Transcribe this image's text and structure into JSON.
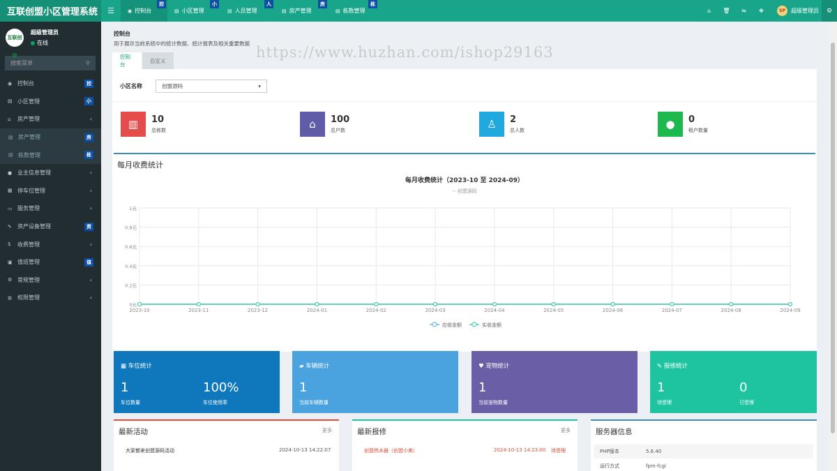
{
  "app": {
    "title": "互联创盟小区管理系统"
  },
  "topnav": [
    {
      "label": "控制台",
      "badge": "控",
      "active": true
    },
    {
      "label": "小区管理",
      "badge": "小",
      "active": false
    },
    {
      "label": "人员管理",
      "badge": "人",
      "active": false
    },
    {
      "label": "房产管理",
      "badge": "房",
      "active": false
    },
    {
      "label": "栋数管理",
      "badge": "栋",
      "active": false
    }
  ],
  "topuser": {
    "name": "超级管理员",
    "avatar_text": "SP"
  },
  "sidebar": {
    "user": {
      "name": "超级管理员",
      "status": "在线",
      "avatar_text": "互联创盟"
    },
    "search_placeholder": "搜索菜单",
    "items": [
      {
        "label": "控制台",
        "badge": "控",
        "icon": "dashboard-icon"
      },
      {
        "label": "小区管理",
        "badge": "小",
        "icon": "list-icon"
      },
      {
        "label": "房产管理",
        "chev": "‹",
        "icon": "home-icon"
      },
      {
        "label": "房产管理",
        "badge": "房",
        "sub": true,
        "icon": "list-icon"
      },
      {
        "label": "栋数管理",
        "badge": "栋",
        "sub": true,
        "icon": "list-icon"
      },
      {
        "label": "业主信息管理",
        "chev": "‹",
        "icon": "user-icon"
      },
      {
        "label": "停车位管理",
        "chev": "‹",
        "icon": "film-icon"
      },
      {
        "label": "服务管理",
        "chev": "‹",
        "icon": "desktop-icon"
      },
      {
        "label": "资产设备管理",
        "badge": "资",
        "icon": "wrench-icon"
      },
      {
        "label": "收费管理",
        "chev": "‹",
        "icon": "dollar-icon"
      },
      {
        "label": "值班管理",
        "badge": "值",
        "icon": "calendar-icon"
      },
      {
        "label": "常规管理",
        "chev": "‹",
        "icon": "cogs-icon"
      },
      {
        "label": "权限管理",
        "chev": "‹",
        "icon": "group-icon"
      }
    ]
  },
  "page": {
    "title": "控制台",
    "desc": "用于展示当前系统中的统计数据、统计报表及相关重要数据",
    "watermark": "https://www.huzhan.com/ishop29163",
    "tabs": [
      "控制台",
      "自定义"
    ]
  },
  "filter": {
    "label": "小区名称",
    "value": "创盟源码"
  },
  "stats": [
    {
      "value": "10",
      "label": "总栋数",
      "color": "#e74c4c",
      "icon": "building-icon"
    },
    {
      "value": "100",
      "label": "总户数",
      "color": "#605ca8",
      "icon": "home-icon"
    },
    {
      "value": "2",
      "label": "总人数",
      "color": "#1fa9df",
      "icon": "male-icon"
    },
    {
      "value": "0",
      "label": "租户数量",
      "color": "#1db94f",
      "icon": "user-icon"
    }
  ],
  "chart_box": {
    "title": "每月收费统计"
  },
  "chart_data": {
    "type": "line",
    "title": "每月收费统计（2023-10 至 2024-09）",
    "subtitle": "-- 创盟源码",
    "categories": [
      "2023-10",
      "2023-11",
      "2023-12",
      "2024-01",
      "2024-02",
      "2024-03",
      "2024-04",
      "2024-05",
      "2024-06",
      "2024-07",
      "2024-08",
      "2024-09"
    ],
    "y_ticks": [
      "0元",
      "0.2元",
      "0.4元",
      "0.6元",
      "0.8元",
      "1元"
    ],
    "ylim": [
      0,
      1
    ],
    "series": [
      {
        "name": "应收金额",
        "values": [
          0,
          0,
          0,
          0,
          0,
          0,
          0,
          0,
          0,
          0,
          0,
          0
        ],
        "color": "#6fb7e0"
      },
      {
        "name": "实收金额",
        "values": [
          0,
          0,
          0,
          0,
          0,
          0,
          0,
          0,
          0,
          0,
          0,
          0
        ],
        "color": "#4ecdb4"
      }
    ],
    "legend": "bottom-center",
    "grid": true
  },
  "color_boxes": [
    {
      "title": "车位统计",
      "icon": "film-icon",
      "color": "#0f78bd",
      "items": [
        {
          "value": "1",
          "label": "车位数量"
        },
        {
          "value": "100%",
          "label": "车位使用率"
        }
      ]
    },
    {
      "title": "车辆统计",
      "icon": "truck-icon",
      "color": "#4aa3df",
      "items": [
        {
          "value": "1",
          "label": "当前车辆数量"
        }
      ]
    },
    {
      "title": "宠物统计",
      "icon": "heart-icon",
      "color": "#6a5ea7",
      "items": [
        {
          "value": "1",
          "label": "当前宠物数量"
        }
      ]
    },
    {
      "title": "报修统计",
      "icon": "wrench-icon",
      "color": "#1ec4a0",
      "items": [
        {
          "value": "1",
          "label": "待受理"
        },
        {
          "value": "0",
          "label": "已受理"
        }
      ]
    }
  ],
  "activities": {
    "title": "最新活动",
    "more": "更多",
    "rows": [
      {
        "text": "大家都来创盟源码活动",
        "time": "2024-10-13 14:22:07"
      }
    ]
  },
  "repairs": {
    "title": "最新报修",
    "more": "更多",
    "rows": [
      {
        "text": "创盟热水器（创盟小美）",
        "time": "2024-10-13 14:23:00",
        "status": "待受理"
      }
    ]
  },
  "server": {
    "title": "服务器信息",
    "rows": [
      {
        "key": "PHP版本",
        "value": "5.6.40"
      },
      {
        "key": "运行方式",
        "value": "fpm-fcgi"
      }
    ]
  }
}
